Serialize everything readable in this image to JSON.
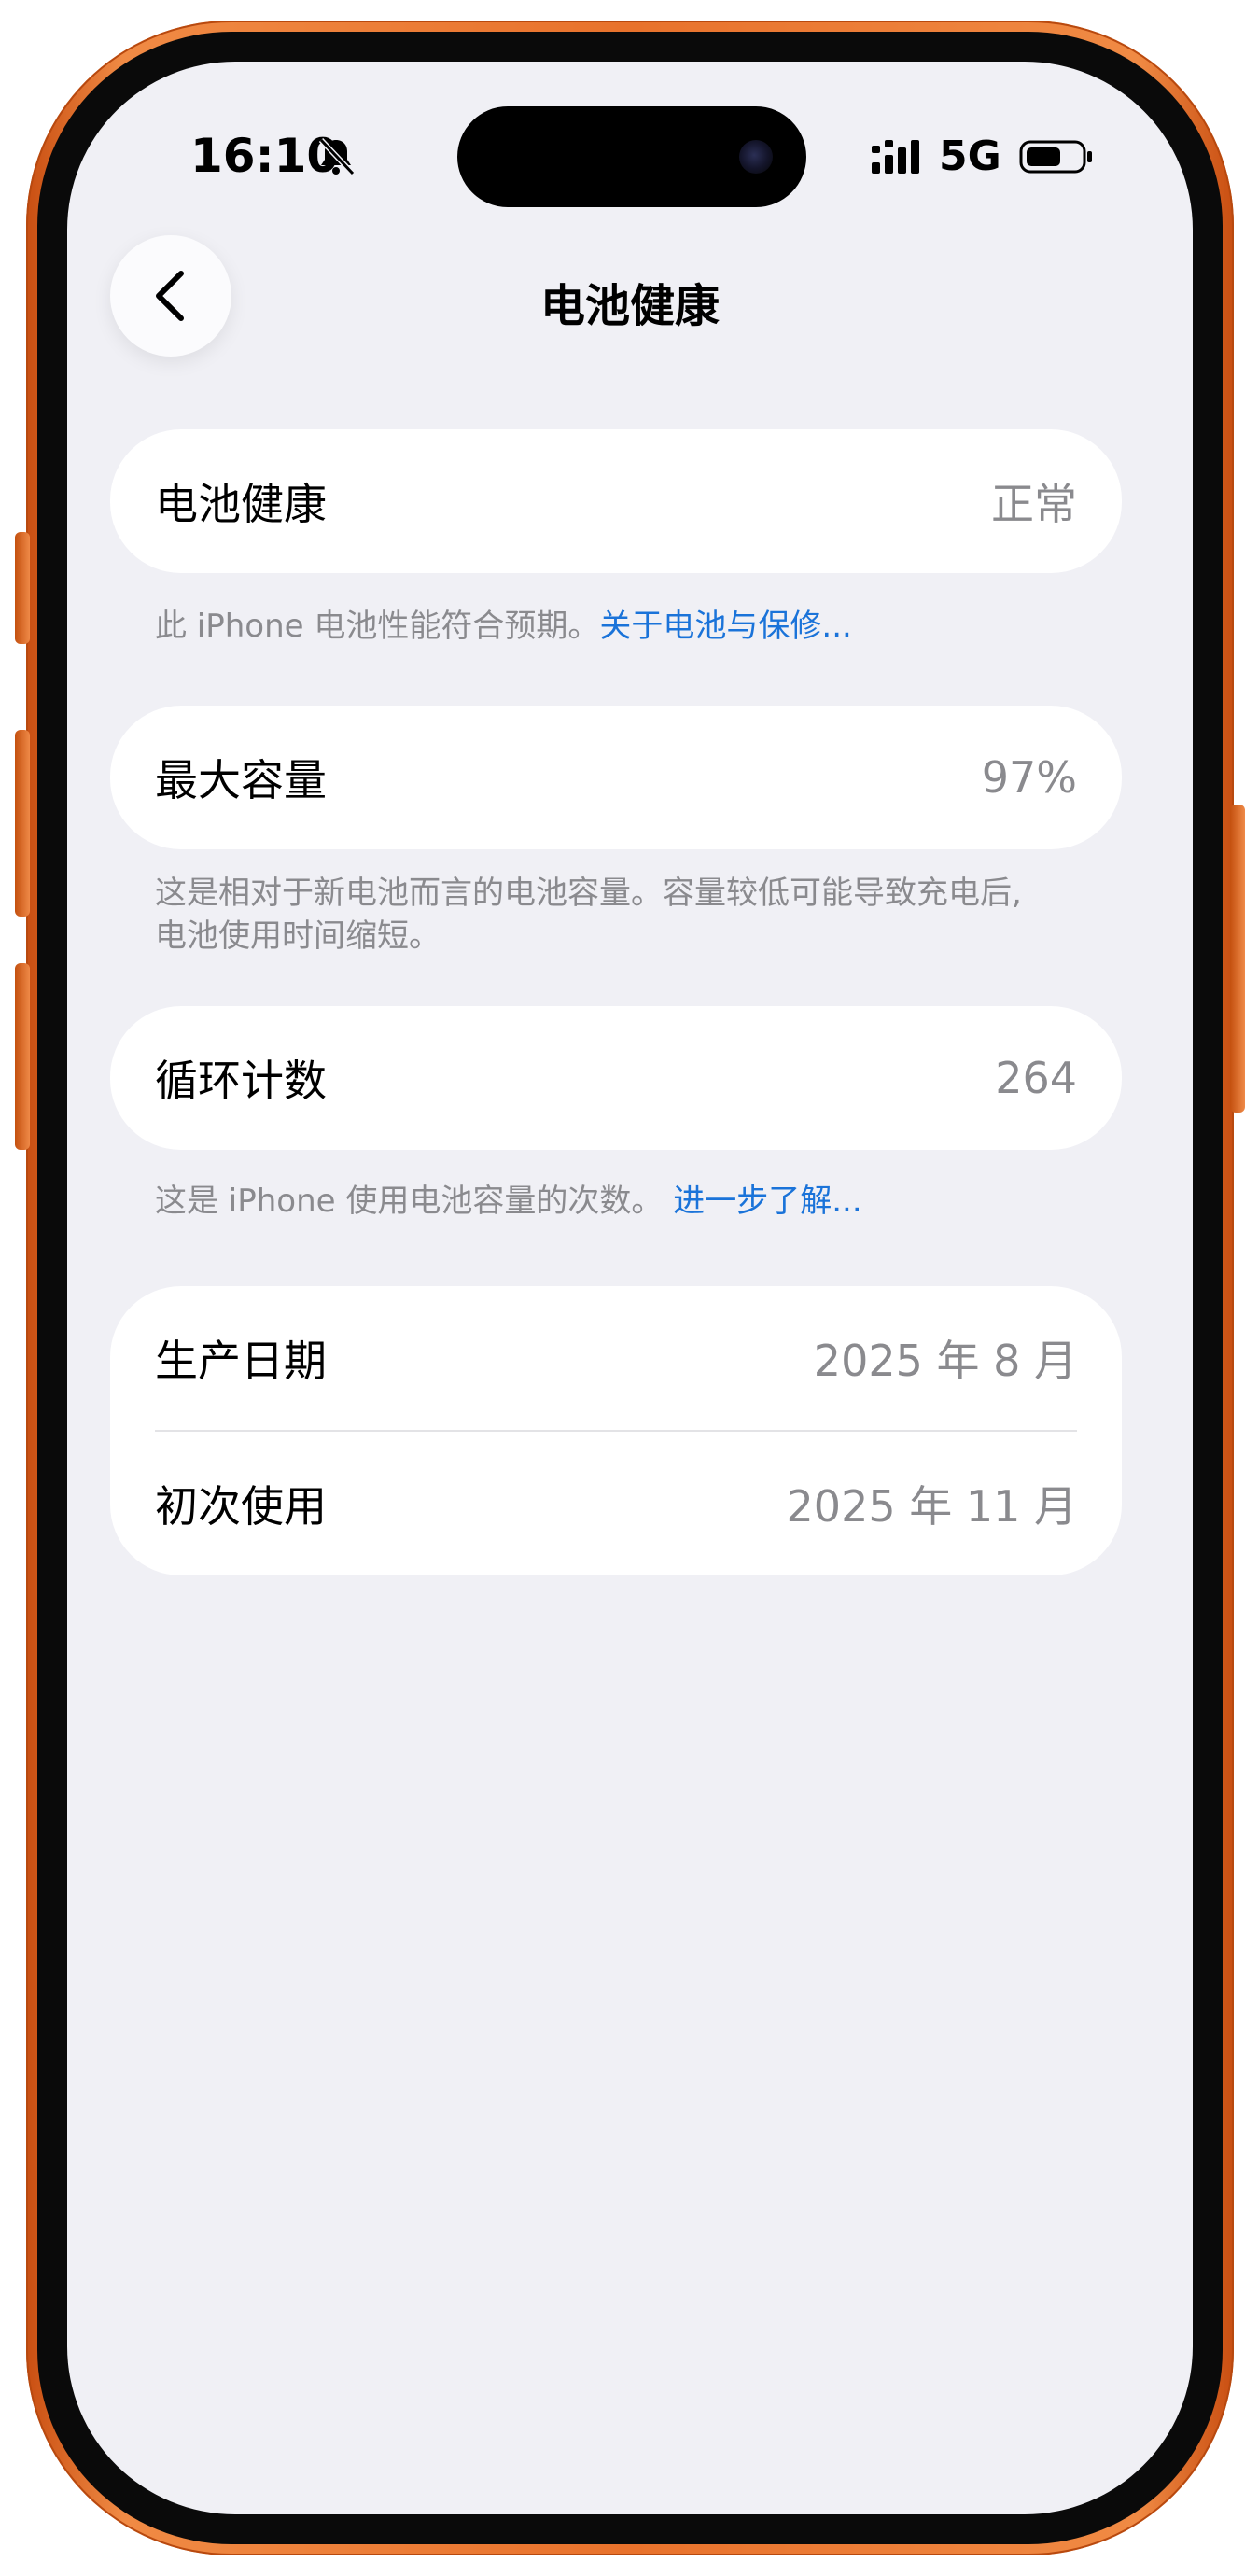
{
  "status_bar": {
    "time": "16:10",
    "network": "5G",
    "icons": [
      "bell-slash-icon",
      "signal-icon",
      "battery-icon"
    ]
  },
  "nav": {
    "title": "电池健康",
    "back_icon": "chevron-left-icon"
  },
  "sections": {
    "health": {
      "label": "电池健康",
      "value": "正常",
      "footnote": "此 iPhone 电池性能符合预期。",
      "link": "关于电池与保修..."
    },
    "capacity": {
      "label": "最大容量",
      "value": "97%",
      "footnote_line1": "这是相对于新电池而言的电池容量。容量较低可能导致充电后,",
      "footnote_line2": "电池使用时间缩短。"
    },
    "cycles": {
      "label": "循环计数",
      "value": "264",
      "footnote": "这是 iPhone 使用电池容量的次数。",
      "link": "进一步了解..."
    },
    "dates": {
      "manufacture_label": "生产日期",
      "manufacture_value": "2025 年 8 月",
      "first_use_label": "初次使用",
      "first_use_value": "2025 年 11 月"
    }
  },
  "colors": {
    "background": "#f0f0f5",
    "card": "#ffffff",
    "link": "#1a73d9",
    "secondary_text": "#8a8a8e",
    "frame": "#e8722c"
  }
}
